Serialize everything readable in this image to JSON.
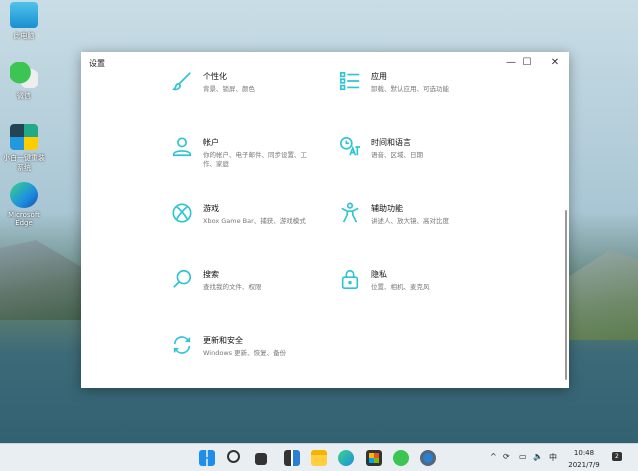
{
  "desktop": {
    "icons": [
      {
        "label": "此电脑"
      },
      {
        "label": "微信"
      },
      {
        "label": "小白一键重装系统"
      },
      {
        "label": "Microsoft Edge"
      }
    ]
  },
  "window": {
    "title": "设置",
    "minimize": "—",
    "maximize": "☐",
    "close": "✕",
    "items": [
      {
        "label": "个性化",
        "desc": "背景、锁屏、颜色",
        "icon": "paintbrush-icon"
      },
      {
        "label": "应用",
        "desc": "卸载、默认应用、可选功能",
        "icon": "apps-list-icon"
      },
      {
        "label": "帐户",
        "desc": "你的帐户、电子邮件、同步设置、工作、家庭",
        "icon": "account-icon"
      },
      {
        "label": "时间和语言",
        "desc": "语音、区域、日期",
        "icon": "time-language-icon"
      },
      {
        "label": "游戏",
        "desc": "Xbox Game Bar、捕获、游戏模式",
        "icon": "xbox-icon"
      },
      {
        "label": "辅助功能",
        "desc": "讲述人、放大镜、高对比度",
        "icon": "accessibility-icon"
      },
      {
        "label": "搜索",
        "desc": "查找我的文件、权限",
        "icon": "search-icon"
      },
      {
        "label": "隐私",
        "desc": "位置、相机、麦克风",
        "icon": "lock-icon"
      },
      {
        "label": "更新和安全",
        "desc": "Windows 更新、恢复、备份",
        "icon": "sync-icon"
      }
    ]
  },
  "taskbar": {
    "time": "10:48",
    "date": "2021/7/9",
    "ime": "中",
    "notifications": "2",
    "accent": "#2ec4d4"
  }
}
